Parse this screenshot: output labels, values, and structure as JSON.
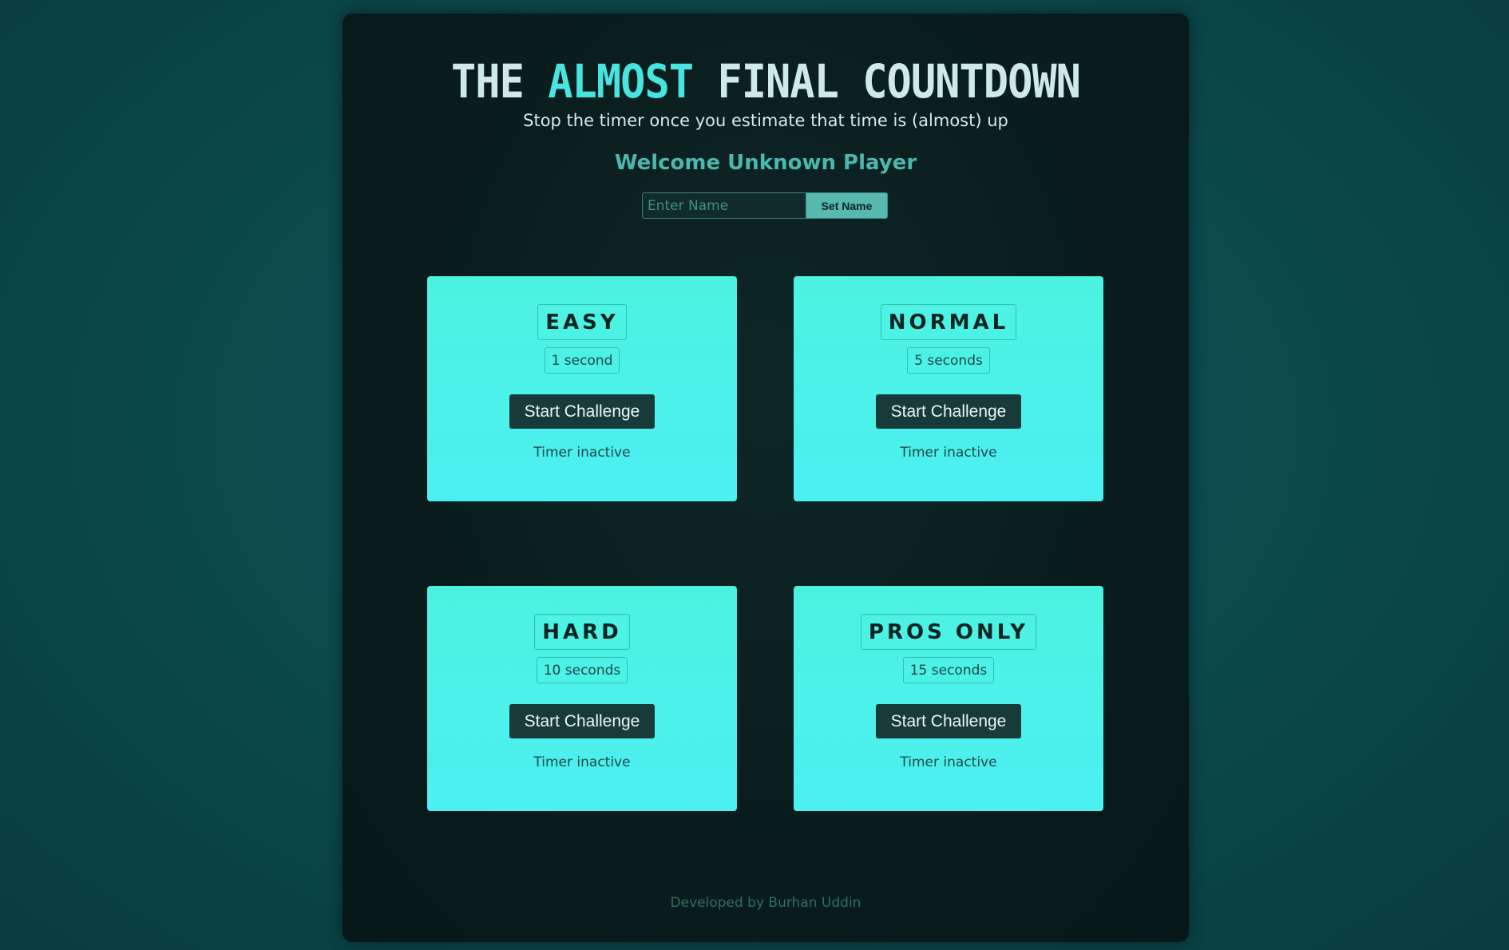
{
  "header": {
    "title_part1": "THE ",
    "title_accent": "ALMOST",
    "title_part2": " FINAL COUNTDOWN",
    "subtitle": "Stop the timer once you estimate that time is (almost) up",
    "welcome": "Welcome Unknown Player"
  },
  "name_form": {
    "placeholder": "Enter Name",
    "value": "",
    "button_label": "Set Name"
  },
  "challenges": [
    {
      "level": "EASY",
      "duration": "1 second",
      "button_label": "Start Challenge",
      "status": "Timer inactive"
    },
    {
      "level": "NORMAL",
      "duration": "5 seconds",
      "button_label": "Start Challenge",
      "status": "Timer inactive"
    },
    {
      "level": "HARD",
      "duration": "10 seconds",
      "button_label": "Start Challenge",
      "status": "Timer inactive"
    },
    {
      "level": "PROS ONLY",
      "duration": "15 seconds",
      "button_label": "Start Challenge",
      "status": "Timer inactive"
    }
  ],
  "footer": {
    "credit": "Developed by Burhan Uddin"
  },
  "colors": {
    "accent": "#47e4e0",
    "card_top": "#4cf2e0",
    "card_bottom": "#4bf0f2",
    "button_dark": "#163b3a",
    "panel_bg": "#0a1c1c"
  }
}
